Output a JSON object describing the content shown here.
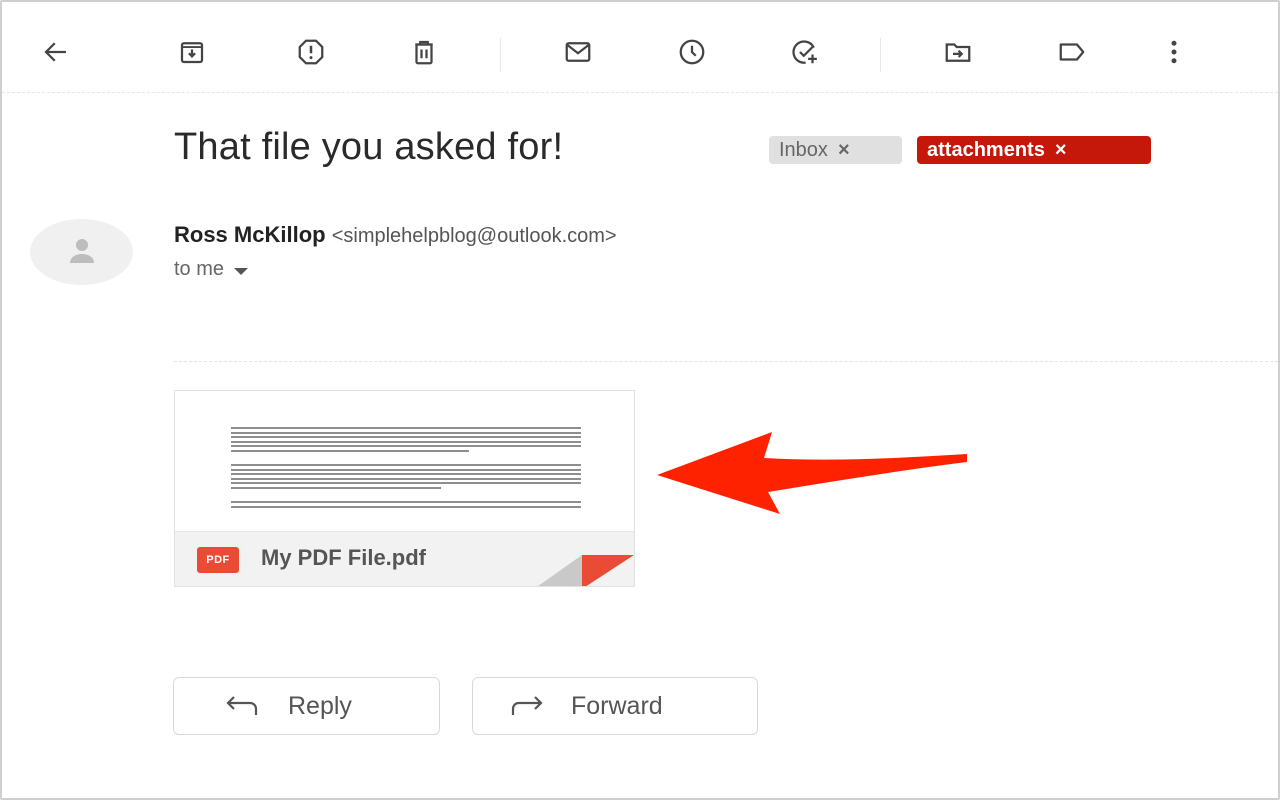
{
  "toolbar": {
    "buttons": [
      {
        "name": "back",
        "icon": "arrow-left-icon"
      },
      {
        "name": "archive",
        "icon": "archive-icon"
      },
      {
        "name": "report-spam",
        "icon": "spam-icon"
      },
      {
        "name": "delete",
        "icon": "trash-icon"
      },
      {
        "name": "mark-unread",
        "icon": "envelope-icon"
      },
      {
        "name": "snooze",
        "icon": "clock-icon"
      },
      {
        "name": "add-to-tasks",
        "icon": "add-task-icon"
      },
      {
        "name": "move-to",
        "icon": "folder-move-icon"
      },
      {
        "name": "labels",
        "icon": "label-icon"
      },
      {
        "name": "more",
        "icon": "more-vert-icon"
      }
    ]
  },
  "email": {
    "subject": "That file you asked for!",
    "labels": [
      {
        "text": "Inbox",
        "close": "×",
        "color": "#e0e0e0"
      },
      {
        "text": "attachments",
        "close": "×",
        "color": "#c5180b"
      }
    ],
    "sender": {
      "name": "Ross McKillop",
      "email": "<simplehelpblog@outlook.com>"
    },
    "recipient": "to me"
  },
  "attachment": {
    "type_badge": "PDF",
    "file_name": "My PDF File.pdf",
    "accent": "#e94b35"
  },
  "annotation": {
    "arrow_color": "#ff2200"
  },
  "actions": {
    "reply": "Reply",
    "forward": "Forward"
  }
}
